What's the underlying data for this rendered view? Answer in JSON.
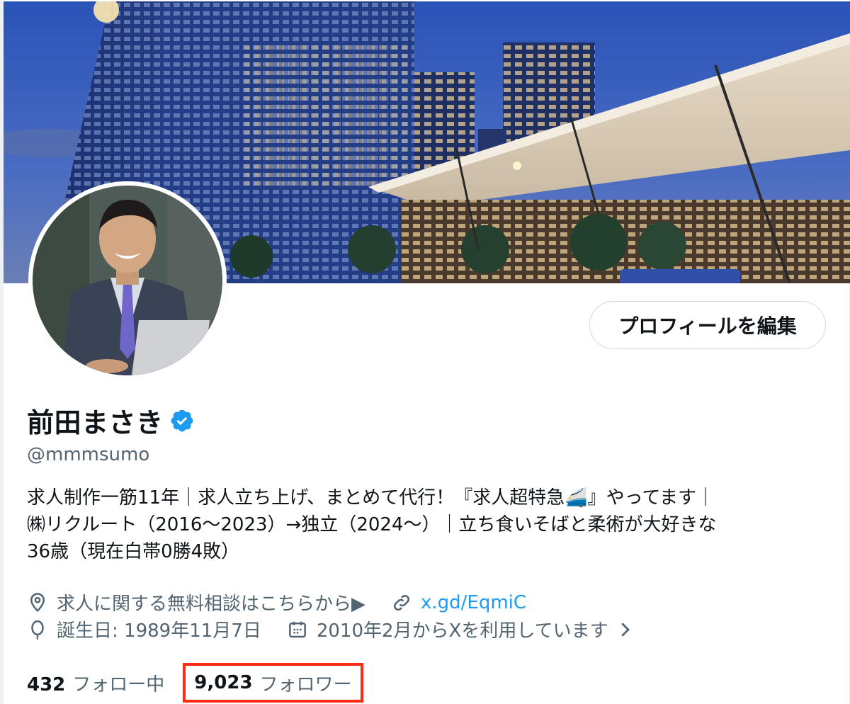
{
  "profile": {
    "display_name": "前田まさき",
    "handle": "@mmmsumo",
    "edit_button_label": "プロフィールを編集",
    "bio_lines": [
      "求人制作一筋11年｜求人立ち上げ、まとめて代行！『求人超特急🚄』やってます｜",
      "㈱リクルート（2016〜2023）→独立（2024〜）｜立ち食いそばと柔術が大好きな",
      "36歳（現在白帯0勝4敗）"
    ],
    "location": "求人に関する無料相談はこちらから▶",
    "link": "x.gd/EqmiC",
    "birthday": "誕生日: 1989年11月7日",
    "joined": "2010年2月からXを利用しています",
    "following_count": "432",
    "following_label": "フォロー中",
    "followers_count": "9,023",
    "followers_label": "フォロワー"
  },
  "colors": {
    "link": "#1d9bf0",
    "verified": "#1d9bf0",
    "highlight_box": "#ff2a14",
    "secondary_text": "#536471"
  },
  "icons": {
    "location": "location-pin-icon",
    "link": "link-icon",
    "birthday": "balloon-icon",
    "joined": "calendar-icon",
    "verified": "verified-badge-icon",
    "more": "chevron-right-icon"
  }
}
